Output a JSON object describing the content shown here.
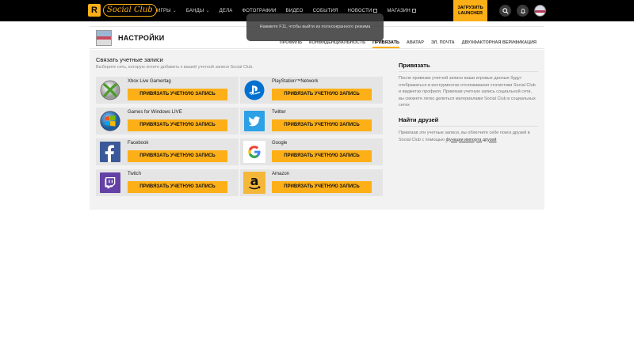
{
  "topbar": {
    "logo_letter": "R",
    "logo_text": "Social Club",
    "nav": [
      {
        "label": "ИГРЫ",
        "caret": true
      },
      {
        "label": "БАНДЫ",
        "caret": true
      },
      {
        "label": "ДЕЛА"
      },
      {
        "label": "ФОТОГРАФИИ"
      },
      {
        "label": "ВИДЕО"
      },
      {
        "label": "СОБЫТИЯ"
      },
      {
        "label": "НОВОСТИ",
        "external": true
      },
      {
        "label": "МАГАЗИН",
        "external": true
      }
    ],
    "launcher_line1": "ЗАГРУЗИТЬ",
    "launcher_line2": "LAUNCHER",
    "icons": [
      "search-icon",
      "bell-icon",
      "avatar"
    ]
  },
  "toast": "Нажмите F11, чтобы выйти из полноэкранного режима",
  "header": {
    "title": "НАСТРОЙКИ",
    "tabs": [
      "ПРОФИЛЬ",
      "КОНФИДЕНЦИАЛЬНОСТЬ",
      "ПРИВЯЗАТЬ",
      "АВАТАР",
      "ЭЛ. ПОЧТА",
      "ДВУХФАКТОРНАЯ ВЕРИФИКАЦИЯ"
    ],
    "active_tab": "ПРИВЯЗАТЬ"
  },
  "main": {
    "title": "Связать учетные записи",
    "description": "Выберите сеть, которую хотите добавить к вашей учетной записи Social Club.",
    "accounts": [
      {
        "name": "Xbox Live Gamertag",
        "icon": "xbox-icon",
        "button": "ПРИВЯЗАТЬ УЧЕТНУЮ ЗАПИСЬ"
      },
      {
        "name": "PlayStation™Network",
        "icon": "playstation-icon",
        "button": "ПРИВЯЗАТЬ УЧЕТНУЮ ЗАПИСЬ"
      },
      {
        "name": "Games for Windows LIVE",
        "icon": "windows-icon",
        "button": "ПРИВЯЗАТЬ УЧЕТНУЮ ЗАПИСЬ"
      },
      {
        "name": "Twitter",
        "icon": "twitter-icon",
        "button": "ПРИВЯЗАТЬ УЧЕТНУЮ ЗАПИСЬ"
      },
      {
        "name": "Facebook",
        "icon": "facebook-icon",
        "button": "ПРИВЯЗАТЬ УЧЕТНУЮ ЗАПИСЬ"
      },
      {
        "name": "Google",
        "icon": "google-icon",
        "button": "ПРИВЯЗАТЬ УЧЕТНУЮ ЗАПИСЬ"
      },
      {
        "name": "Twitch",
        "icon": "twitch-icon",
        "button": "ПРИВЯЗАТЬ УЧЕТНУЮ ЗАПИСЬ"
      },
      {
        "name": "Amazon",
        "icon": "amazon-icon",
        "button": "ПРИВЯЗАТЬ УЧЕТНУЮ ЗАПИСЬ"
      }
    ]
  },
  "sidebar": {
    "link_title": "Привязать",
    "link_text": "После привязки учетной записи ваши игровые данные будут отображаться в инструментах отслеживания статистики Social Club и виджетах профиля. Привязав учетную запись социальной сети, вы сможете легко делиться материалами Social Club в социальных сетях",
    "friends_title": "Найти друзей",
    "friends_text": "Привязав эти учетные записи, вы облегчите себе поиск друзей в Social Club с помощью",
    "friends_link": "функции импорта друзей"
  },
  "colors": {
    "accent": "#fcaf17",
    "topbar": "#000000",
    "panel": "#f2f2f2",
    "card": "#e5e5e5"
  }
}
